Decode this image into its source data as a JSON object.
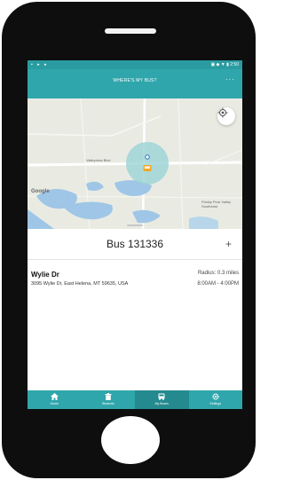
{
  "status_bar": {
    "left_icons": "▪ ▸ ▸",
    "right_icons": "▣ ◆ ▼ ▮",
    "time": "2:50"
  },
  "app_bar": {
    "title": "WHERE'S MY BUS?",
    "more_label": "···"
  },
  "map": {
    "google_label": "Google",
    "road_label": "Valleyview Blvd",
    "area_label_line1": "Prickly Pear Valley",
    "area_label_line2": "Southeast",
    "locate_icon": "crosshair-icon",
    "water_color": "#9fc6e6",
    "radius_color": "#9bd3d6"
  },
  "sheet": {
    "bus_title": "Bus 131336",
    "add_label": "+"
  },
  "stop": {
    "name": "Wylie Dr",
    "address": "3095 Wylie Dr, East Helena, MT 59635, USA",
    "radius": "Radius: 0.3 miles",
    "hours": "8:00AM - 4:00PM"
  },
  "nav": {
    "accent_color": "#2fa6ab",
    "items": [
      {
        "label": "Home",
        "icon": "home-icon"
      },
      {
        "label": "Students",
        "icon": "trash-icon"
      },
      {
        "label": "My Buses",
        "icon": "bus-icon"
      },
      {
        "label": "Settings",
        "icon": "gear-icon"
      }
    ]
  }
}
